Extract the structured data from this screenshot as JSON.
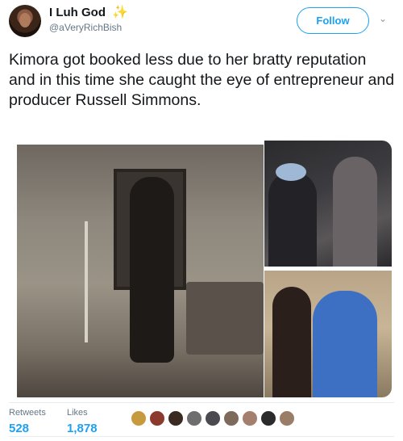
{
  "user": {
    "display_name": "I Luh God",
    "badge_icon": "sparkle-icon",
    "handle": "@aVeryRichBish"
  },
  "follow_button": {
    "label": "Follow"
  },
  "tweet": {
    "text": "Kimora got booked less due to her bratty reputation and in this time she caught the eye of entrepreneur and producer Russell Simmons."
  },
  "stats": {
    "retweets_label": "Retweets",
    "retweets_value": "528",
    "likes_label": "Likes",
    "likes_value": "1,878"
  },
  "likers": [
    {
      "color": "#c79a3e"
    },
    {
      "color": "#8c3a2e"
    },
    {
      "color": "#3a2a22"
    },
    {
      "color": "#6e6e6e"
    },
    {
      "color": "#4a4a50"
    },
    {
      "color": "#7d6a5a"
    },
    {
      "color": "#a57f6e"
    },
    {
      "color": "#2b2b2b"
    },
    {
      "color": "#9a7d66"
    }
  ]
}
